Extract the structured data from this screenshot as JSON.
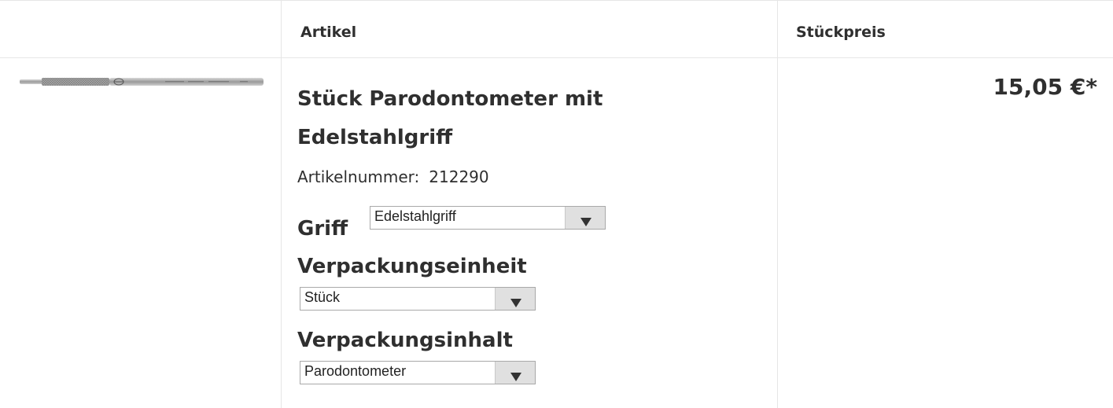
{
  "table": {
    "header": {
      "article_label": "Artikel",
      "unit_price_label": "Stückpreis"
    }
  },
  "product": {
    "image_icon": "dental-instrument-image",
    "title": "Stück Parodontometer mit Edelstahlgriff",
    "article_number_label": "Artikelnummer:",
    "article_number": "212290",
    "price": "15,05 €*",
    "options": {
      "griff": {
        "label": "Griff",
        "selected": "Edelstahlgriff"
      },
      "verpackungseinheit": {
        "label": "Verpackungseinheit",
        "selected": "Stück"
      },
      "verpackungsinhalt": {
        "label": "Verpackungsinhalt",
        "selected": "Parodontometer"
      }
    }
  },
  "colors": {
    "text": "#2f2f2f",
    "border": "#e6e6e6",
    "select_button": "#e0e0e0"
  }
}
